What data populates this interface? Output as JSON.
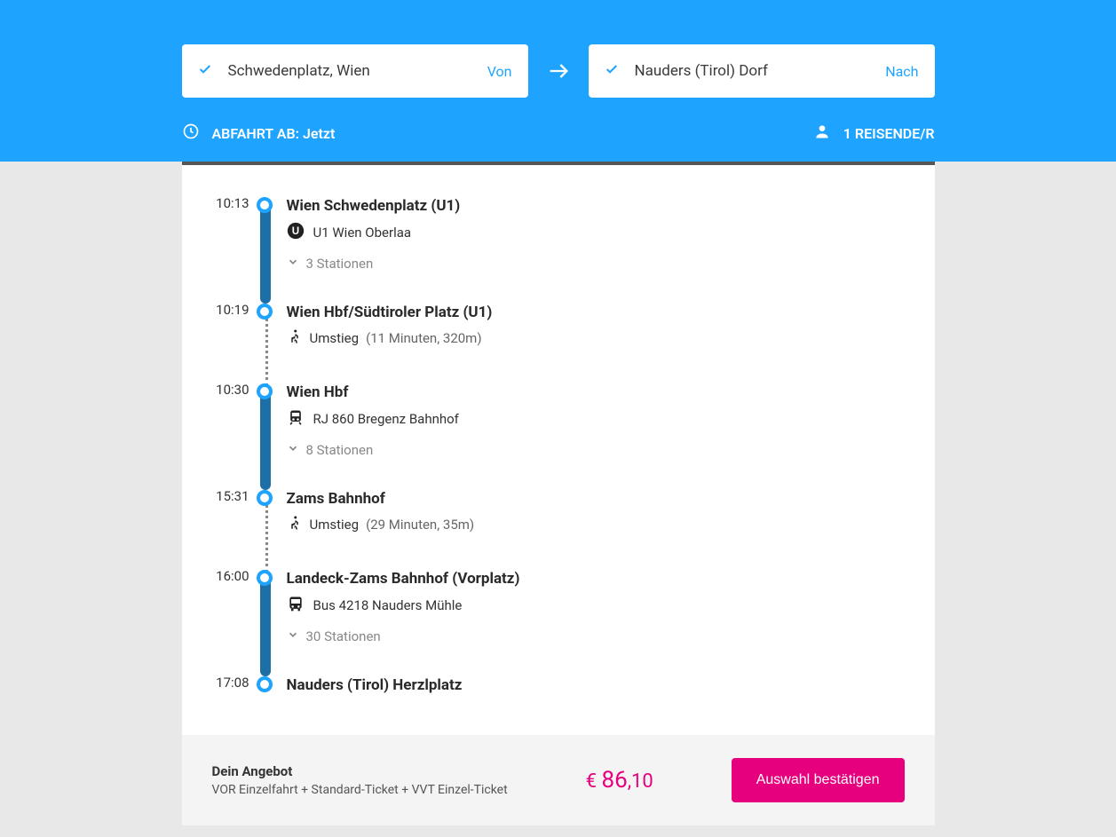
{
  "search": {
    "from_value": "Schwedenplatz, Wien",
    "from_label": "Von",
    "to_value": "Nauders (Tirol) Dorf",
    "to_label": "Nach"
  },
  "meta": {
    "departure_label": "ABFAHRT AB: Jetzt",
    "travelers": "1 REISENDE/R"
  },
  "segments": [
    {
      "dep_time": "10:13",
      "dep_station": "Wien Schwedenplatz (U1)",
      "line": "U1 Wien Oberlaa",
      "line_icon": "ubahn",
      "expand": "3 Stationen",
      "arr_time": "10:19",
      "arr_station": "Wien Hbf/Südtiroler Platz (U1)",
      "transfer_label": "Umstieg",
      "transfer_detail": "(11 Minuten, 320m)"
    },
    {
      "dep_time": "10:30",
      "dep_station": "Wien Hbf",
      "line": "RJ 860 Bregenz Bahnhof",
      "line_icon": "train",
      "expand": "8 Stationen",
      "arr_time": "15:31",
      "arr_station": "Zams Bahnhof",
      "transfer_label": "Umstieg",
      "transfer_detail": "(29 Minuten, 35m)"
    },
    {
      "dep_time": "16:00",
      "dep_station": "Landeck-Zams Bahnhof (Vorplatz)",
      "line": "Bus 4218 Nauders Mühle",
      "line_icon": "bus",
      "expand": "30 Stationen",
      "arr_time": "17:08",
      "arr_station": "Nauders (Tirol) Herzlplatz"
    }
  ],
  "offer": {
    "title": "Dein Angebot",
    "subtitle": "VOR Einzelfahrt + Standard-Ticket + VVT Einzel-Ticket",
    "currency": "€",
    "price_main": "86",
    "price_cents": ",10",
    "confirm": "Auswahl bestätigen"
  }
}
